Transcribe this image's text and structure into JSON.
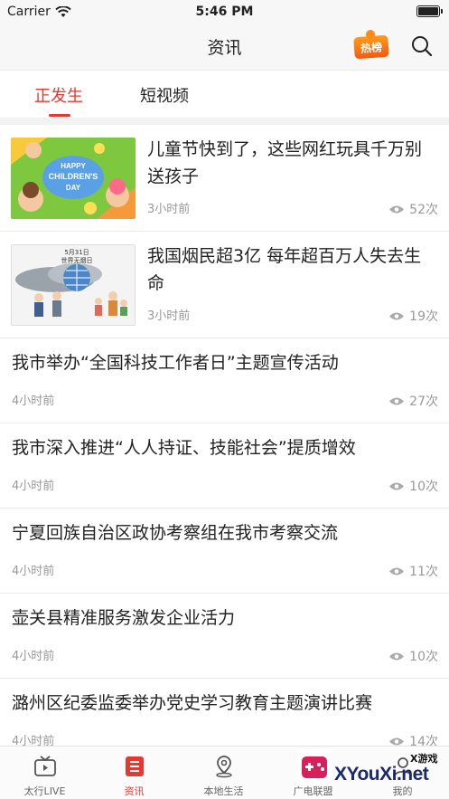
{
  "status_bar": {
    "carrier": "Carrier",
    "time": "5:46 PM"
  },
  "header": {
    "title": "资讯",
    "hot_badge": "热榜",
    "search_icon": "search-icon"
  },
  "tabs": [
    {
      "label": "正发生",
      "active": true
    },
    {
      "label": "短视频",
      "active": false
    }
  ],
  "news": [
    {
      "title": "儿童节快到了，这些网红玩具千万别送孩子",
      "time": "3小时前",
      "views": "52次",
      "thumb_text": [
        "HAPPY",
        "CHILDREN'S",
        "DAY"
      ]
    },
    {
      "title": "我国烟民超3亿 每年超百万人失去生命",
      "time": "3小时前",
      "views": "19次",
      "thumb_text": [
        "5月31日",
        "世界无烟日"
      ]
    },
    {
      "title": "我市举办“全国科技工作者日”主题宣传活动",
      "time": "4小时前",
      "views": "27次"
    },
    {
      "title": "我市深入推进“人人持证、技能社会”提质增效",
      "time": "4小时前",
      "views": "10次"
    },
    {
      "title": "宁夏回族自治区政协考察组在我市考察交流",
      "time": "4小时前",
      "views": "11次"
    },
    {
      "title": "壶关县精准服务激发企业活力",
      "time": "4小时前",
      "views": "10次"
    },
    {
      "title": "潞州区纪委监委举办党史学习教育主题演讲比赛",
      "time": "4小时前",
      "views": "14次"
    }
  ],
  "tab_bar": [
    {
      "label": "太行LIVE",
      "icon": "tv-icon",
      "active": false
    },
    {
      "label": "资讯",
      "icon": "news-icon",
      "active": true
    },
    {
      "label": "本地生活",
      "icon": "location-icon",
      "active": false
    },
    {
      "label": "广电联盟",
      "icon": "grid-icon",
      "active": false
    },
    {
      "label": "我的",
      "icon": "user-icon",
      "active": false
    }
  ],
  "watermark": {
    "small": "X游戏",
    "main": "XYouXi.net"
  },
  "colors": {
    "accent": "#e23a31",
    "nav_bg": "#f7f7f7",
    "meta_text": "#999999"
  }
}
